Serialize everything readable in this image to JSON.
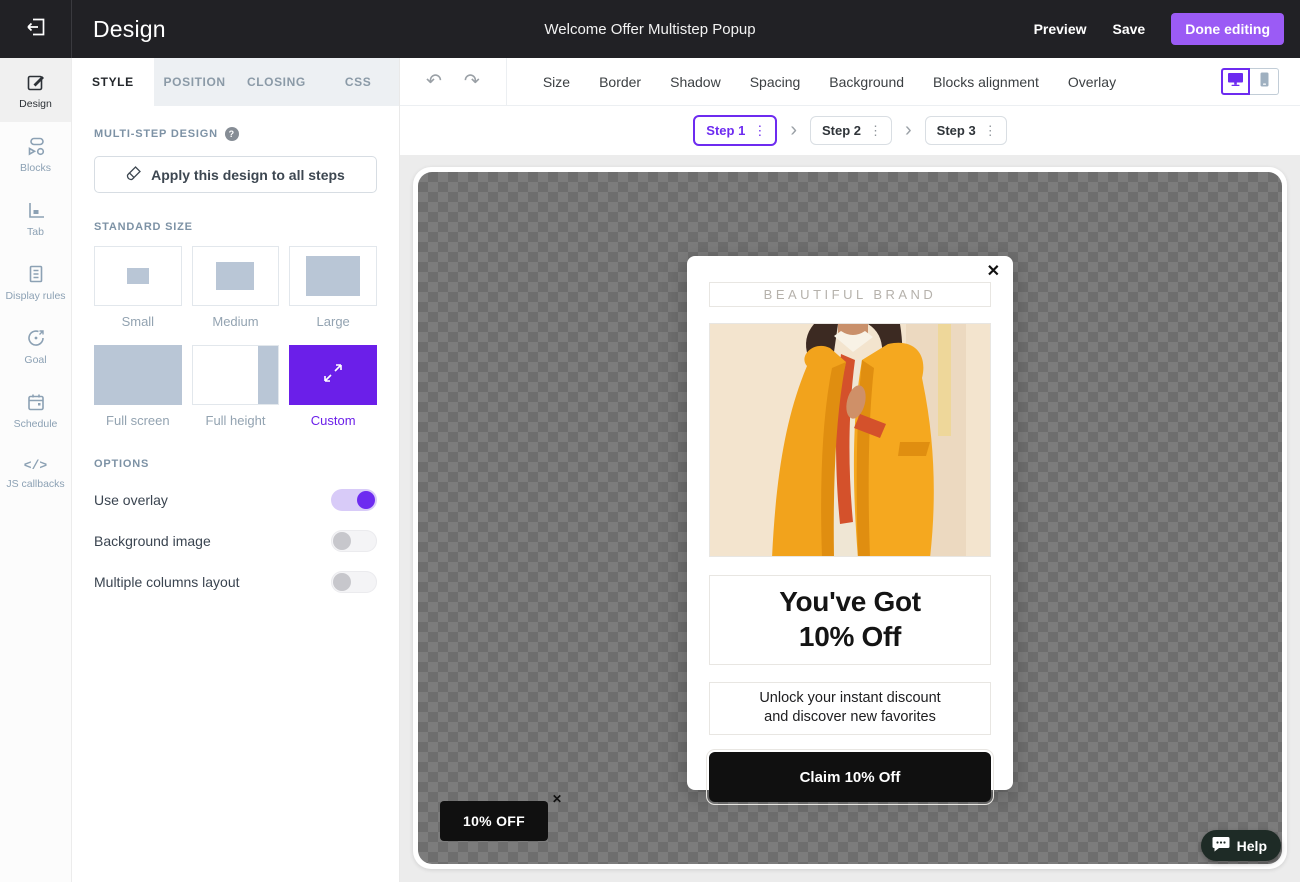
{
  "topbar": {
    "app_title": "Design",
    "doc_title": "Welcome Offer Multistep Popup",
    "preview_label": "Preview",
    "save_label": "Save",
    "done_label": "Done editing"
  },
  "sidebar": {
    "items": [
      {
        "label": "Design",
        "active": true
      },
      {
        "label": "Blocks",
        "active": false
      },
      {
        "label": "Tab",
        "active": false
      },
      {
        "label": "Display rules",
        "active": false
      },
      {
        "label": "Goal",
        "active": false
      },
      {
        "label": "Schedule",
        "active": false
      },
      {
        "label": "JS callbacks",
        "active": false
      }
    ]
  },
  "panel": {
    "tabs": {
      "0": "STYLE",
      "1": "POSITION",
      "2": "CLOSING",
      "3": "CSS",
      "active": "STYLE"
    },
    "multi_step": {
      "heading": "MULTI-STEP DESIGN",
      "apply_button": "Apply this design to all steps"
    },
    "standard_size": {
      "heading": "STANDARD SIZE",
      "labels": {
        "0": "Small",
        "1": "Medium",
        "2": "Large",
        "3": "Full screen",
        "4": "Full height",
        "5": "Custom"
      },
      "selected": "Custom"
    },
    "options": {
      "heading": "OPTIONS",
      "toggles": [
        {
          "label": "Use overlay",
          "state": "on"
        },
        {
          "label": "Background image",
          "state": "off"
        },
        {
          "label": "Multiple columns layout",
          "state": "off"
        }
      ]
    }
  },
  "toolbar": {
    "menu": {
      "0": "Size",
      "1": "Border",
      "2": "Shadow",
      "3": "Spacing",
      "4": "Background",
      "5": "Blocks alignment",
      "6": "Overlay"
    }
  },
  "steps": {
    "0": {
      "label": "Step 1",
      "active": true
    },
    "1": {
      "label": "Step 2",
      "active": false
    },
    "2": {
      "label": "Step 3",
      "active": false
    }
  },
  "popup": {
    "brand": "BEAUTIFUL BRAND",
    "heading_line1": "You've Got",
    "heading_line2": "10% Off",
    "subtext_line1": "Unlock your instant discount",
    "subtext_line2": "and discover new favorites",
    "cta": "Claim 10% Off"
  },
  "tab_widget": {
    "label": "10% OFF"
  },
  "help": {
    "label": "Help"
  },
  "icons": {
    "close": "✕",
    "undo": "↶",
    "redo": "↷",
    "kebab": "⋮",
    "chevron": "›",
    "question": "?"
  },
  "colors": {
    "accent_purple": "#6d2bf0",
    "button_purple": "#9b5bf5",
    "topbar_bg": "#212125",
    "placeholder_gray_blue": "#b9c6d6",
    "checker_light": "#7c7c7c",
    "checker_dark": "#6e6e6e",
    "popup_black": "#101010",
    "help_pill_bg": "#1e2b26"
  }
}
